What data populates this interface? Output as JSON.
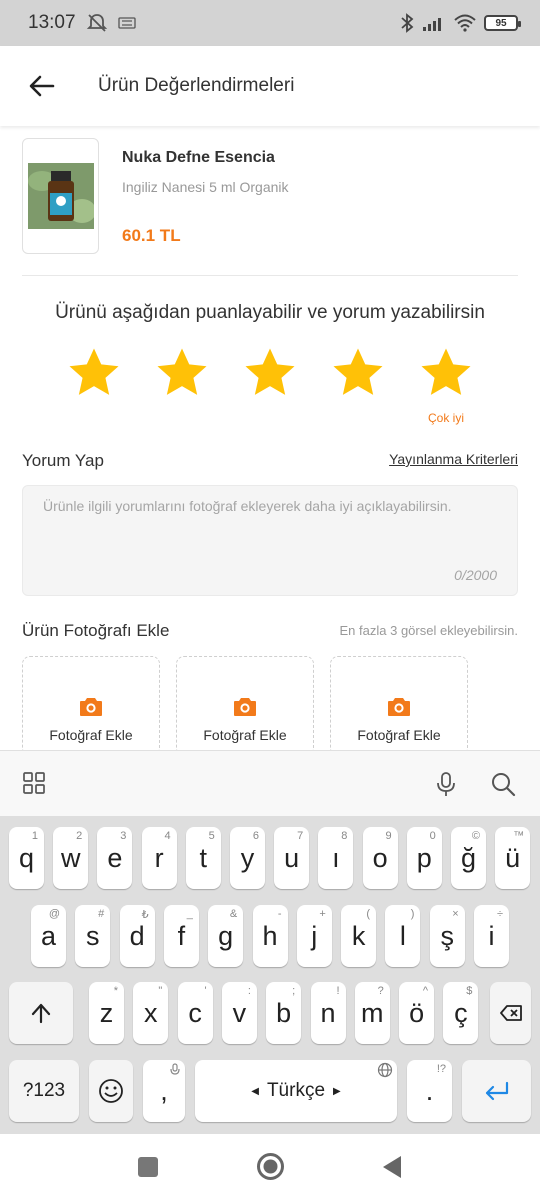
{
  "status_bar": {
    "time": "13:07",
    "battery": "95"
  },
  "header": {
    "title": "Ürün Değerlendirmeleri"
  },
  "product": {
    "name": "Nuka Defne Esencia",
    "variant": "Ingiliz Nanesi 5 ml Organik",
    "price": "60.1 TL"
  },
  "rating": {
    "prompt": "Ürünü aşağıdan puanlayabilir ve yorum yazabilirsin",
    "value": 5,
    "max": 5,
    "label": "Çok iyi",
    "star_color": "#ffc107"
  },
  "comment": {
    "title": "Yorum Yap",
    "criteria_link": "Yayınlanma Kriterleri",
    "placeholder": "Ürünle ilgili yorumlarını fotoğraf ekleyerek daha iyi açıklayabilirsin.",
    "counter": "0/2000"
  },
  "photos": {
    "title": "Ürün Fotoğrafı Ekle",
    "hint": "En fazla 3 görsel ekleyebilirsin.",
    "slots": [
      "Fotoğraf Ekle",
      "Fotoğraf Ekle",
      "Fotoğraf Ekle"
    ],
    "accent": "#f27a1a"
  },
  "keyboard": {
    "row1": [
      {
        "k": "q",
        "h": "1"
      },
      {
        "k": "w",
        "h": "2"
      },
      {
        "k": "e",
        "h": "3"
      },
      {
        "k": "r",
        "h": "4"
      },
      {
        "k": "t",
        "h": "5"
      },
      {
        "k": "y",
        "h": "6"
      },
      {
        "k": "u",
        "h": "7"
      },
      {
        "k": "ı",
        "h": "8"
      },
      {
        "k": "o",
        "h": "9"
      },
      {
        "k": "p",
        "h": "0"
      },
      {
        "k": "ğ",
        "h": "©"
      },
      {
        "k": "ü",
        "h": "™"
      }
    ],
    "row2": [
      {
        "k": "a",
        "h": "@"
      },
      {
        "k": "s",
        "h": "#"
      },
      {
        "k": "d",
        "h": "₺"
      },
      {
        "k": "f",
        "h": "_"
      },
      {
        "k": "g",
        "h": "&"
      },
      {
        "k": "h",
        "h": "-"
      },
      {
        "k": "j",
        "h": "+"
      },
      {
        "k": "k",
        "h": "("
      },
      {
        "k": "l",
        "h": ")"
      },
      {
        "k": "ş",
        "h": "×"
      },
      {
        "k": "i",
        "h": "÷"
      }
    ],
    "row3": [
      {
        "k": "z",
        "h": "*"
      },
      {
        "k": "x",
        "h": "\""
      },
      {
        "k": "c",
        "h": "'"
      },
      {
        "k": "v",
        "h": ":"
      },
      {
        "k": "b",
        "h": ";"
      },
      {
        "k": "n",
        "h": "!"
      },
      {
        "k": "m",
        "h": "?"
      },
      {
        "k": "ö",
        "h": "^"
      },
      {
        "k": "ç",
        "h": "$"
      }
    ],
    "symbols_key": "?123",
    "comma_key": ",",
    "space_label": "Türkçe",
    "period_key": ".",
    "period_hint": "!?"
  }
}
